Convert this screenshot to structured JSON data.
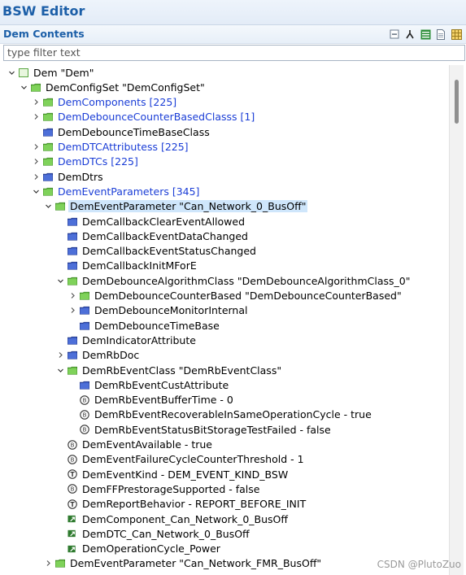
{
  "app": {
    "title": "BSW Editor"
  },
  "section": {
    "title": "Dem Contents"
  },
  "filter": {
    "placeholder": "type filter text",
    "value": ""
  },
  "colors": {
    "accent": "#1c5fa8",
    "link": "#1a3dd6",
    "selection": "#cfe6fb",
    "folder_green": "#6fc24a",
    "folder_blue": "#3e5fc8"
  },
  "tree": [
    {
      "label": "Dem \"Dem\"",
      "depth": 0,
      "twisty": "expanded",
      "icon": "module-icon",
      "color": "black"
    },
    {
      "label": "DemConfigSet \"DemConfigSet\"",
      "depth": 1,
      "twisty": "expanded",
      "icon": "folder-green-icon",
      "color": "black"
    },
    {
      "label": "DemComponents [225]",
      "depth": 2,
      "twisty": "collapsed",
      "icon": "folder-green-icon",
      "color": "blue"
    },
    {
      "label": "DemDebounceCounterBasedClasss [1]",
      "depth": 2,
      "twisty": "collapsed",
      "icon": "folder-green-icon",
      "color": "blue"
    },
    {
      "label": "DemDebounceTimeBaseClass",
      "depth": 2,
      "twisty": "none",
      "icon": "folder-blue-icon",
      "color": "black"
    },
    {
      "label": "DemDTCAttributess [225]",
      "depth": 2,
      "twisty": "collapsed",
      "icon": "folder-green-icon",
      "color": "blue"
    },
    {
      "label": "DemDTCs [225]",
      "depth": 2,
      "twisty": "collapsed",
      "icon": "folder-green-icon",
      "color": "blue"
    },
    {
      "label": "DemDtrs",
      "depth": 2,
      "twisty": "collapsed",
      "icon": "folder-blue-icon",
      "color": "black"
    },
    {
      "label": "DemEventParameters [345]",
      "depth": 2,
      "twisty": "expanded",
      "icon": "folder-green-icon",
      "color": "blue"
    },
    {
      "label": "DemEventParameter \"Can_Network_0_BusOff\"",
      "depth": 3,
      "twisty": "expanded",
      "icon": "folder-green-icon",
      "color": "black",
      "selected": true
    },
    {
      "label": "DemCallbackClearEventAllowed",
      "depth": 4,
      "twisty": "none",
      "icon": "folder-blue-icon",
      "color": "black"
    },
    {
      "label": "DemCallbackEventDataChanged",
      "depth": 4,
      "twisty": "none",
      "icon": "folder-blue-icon",
      "color": "black"
    },
    {
      "label": "DemCallbackEventStatusChanged",
      "depth": 4,
      "twisty": "none",
      "icon": "folder-blue-icon",
      "color": "black"
    },
    {
      "label": "DemCallbackInitMForE",
      "depth": 4,
      "twisty": "none",
      "icon": "folder-blue-icon",
      "color": "black"
    },
    {
      "label": "DemDebounceAlgorithmClass \"DemDebounceAlgorithmClass_0\"",
      "depth": 4,
      "twisty": "expanded",
      "icon": "folder-green-icon",
      "color": "black"
    },
    {
      "label": "DemDebounceCounterBased \"DemDebounceCounterBased\"",
      "depth": 5,
      "twisty": "collapsed",
      "icon": "folder-green-icon",
      "color": "black"
    },
    {
      "label": "DemDebounceMonitorInternal",
      "depth": 5,
      "twisty": "collapsed",
      "icon": "folder-blue-icon",
      "color": "black"
    },
    {
      "label": "DemDebounceTimeBase",
      "depth": 5,
      "twisty": "none",
      "icon": "folder-blue-icon",
      "color": "black"
    },
    {
      "label": "DemIndicatorAttribute",
      "depth": 4,
      "twisty": "none",
      "icon": "folder-blue-icon",
      "color": "black"
    },
    {
      "label": "DemRbDoc",
      "depth": 4,
      "twisty": "collapsed",
      "icon": "folder-blue-icon",
      "color": "black"
    },
    {
      "label": "DemRbEventClass \"DemRbEventClass\"",
      "depth": 4,
      "twisty": "expanded",
      "icon": "folder-green-icon",
      "color": "black"
    },
    {
      "label": "DemRbEventCustAttribute",
      "depth": 5,
      "twisty": "none",
      "icon": "folder-blue-icon",
      "color": "black"
    },
    {
      "label": "DemRbEventBufferTime - 0",
      "depth": 5,
      "twisty": "none",
      "icon": "integer-param-icon",
      "color": "black"
    },
    {
      "label": "DemRbEventRecoverableInSameOperationCycle - true",
      "depth": 5,
      "twisty": "none",
      "icon": "integer-param-icon",
      "color": "black"
    },
    {
      "label": "DemRbEventStatusBitStorageTestFailed - false",
      "depth": 5,
      "twisty": "none",
      "icon": "integer-param-icon",
      "color": "black"
    },
    {
      "label": "DemEventAvailable - true",
      "depth": 4,
      "twisty": "none",
      "icon": "integer-param-icon",
      "color": "black"
    },
    {
      "label": "DemEventFailureCycleCounterThreshold - 1",
      "depth": 4,
      "twisty": "none",
      "icon": "integer-param-icon",
      "color": "black"
    },
    {
      "label": "DemEventKind - DEM_EVENT_KIND_BSW",
      "depth": 4,
      "twisty": "none",
      "icon": "text-param-icon",
      "color": "black"
    },
    {
      "label": "DemFFPrestorageSupported - false",
      "depth": 4,
      "twisty": "none",
      "icon": "integer-param-icon",
      "color": "black"
    },
    {
      "label": "DemReportBehavior - REPORT_BEFORE_INIT",
      "depth": 4,
      "twisty": "none",
      "icon": "text-param-icon",
      "color": "black"
    },
    {
      "label": "DemComponent_Can_Network_0_BusOff",
      "depth": 4,
      "twisty": "none",
      "icon": "reference-icon",
      "color": "black"
    },
    {
      "label": "DemDTC_Can_Network_0_BusOff",
      "depth": 4,
      "twisty": "none",
      "icon": "reference-icon",
      "color": "black"
    },
    {
      "label": "DemOperationCycle_Power",
      "depth": 4,
      "twisty": "none",
      "icon": "reference-icon",
      "color": "black"
    },
    {
      "label": "DemEventParameter \"Can_Network_FMR_BusOff\"",
      "depth": 3,
      "twisty": "collapsed",
      "icon": "folder-green-icon",
      "color": "black"
    }
  ],
  "watermark": "CSDN @PlutoZuo"
}
